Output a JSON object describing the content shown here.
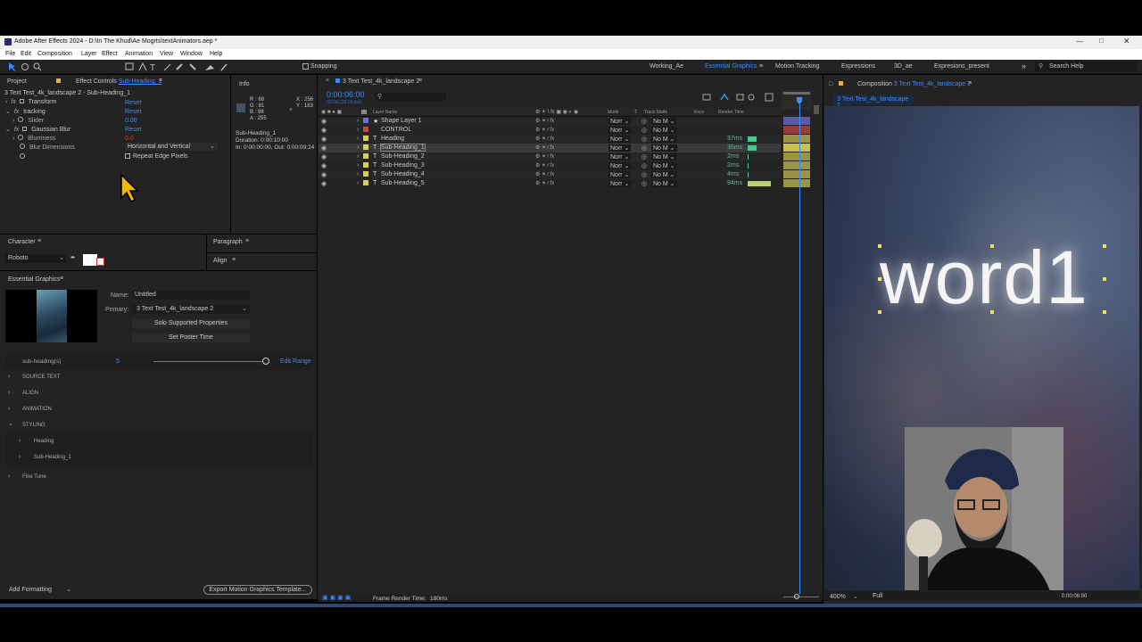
{
  "window": {
    "title": "Adobe After Effects 2024 - D:\\In The Khud\\Ae Mogrts\\textAnimators.aep *"
  },
  "menu": [
    "File",
    "Edit",
    "Composition",
    "Layer",
    "Effect",
    "Animation",
    "View",
    "Window",
    "Help"
  ],
  "toolbar": {
    "snapping": "Snapping",
    "workspaces": [
      "Working_Ae",
      "Essential Graphics",
      "Motion Tracking",
      "Expressions",
      "3D_ae",
      "Expresions_present"
    ],
    "active_workspace": "Essential Graphics",
    "search": "Search Help"
  },
  "effect_controls": {
    "tab_project": "Project",
    "tab_prefix": "Effect Controls",
    "tab_layer": "Sub-Heading_1",
    "header": "3 Text Test_4k_landscape 2 - Sub-Heading_1",
    "rows": [
      {
        "label": "Transform",
        "value": "Reset"
      },
      {
        "label": "tracking",
        "value": "Reset"
      },
      {
        "label": "Slider",
        "value": "0.00"
      },
      {
        "label": "Gaussian Blur",
        "value": "Reset"
      },
      {
        "label": "Blurriness",
        "value": "0.0"
      },
      {
        "label": "Blur Dimensions",
        "value": "Horizontal and Vertical"
      }
    ],
    "repeat_edge": "Repeat Edge Pixels"
  },
  "info": {
    "tab": "Info",
    "r": "R : 68",
    "g": "G : 81",
    "b": "B : 98",
    "a": "A : 255",
    "x": "X : 256",
    "y": "Y : 183",
    "layer": "Sub-Heading_1",
    "duration": "Duration: 0:00:10:00",
    "inout": "In: 0:00:00:00, Out: 0:00:09:24"
  },
  "timeline": {
    "tab": "3 Text Test_4k_landscape 2",
    "timecode": "0:00:06:00",
    "fps": "00150 (25.00 fps)",
    "col_layer_name": "Layer Name",
    "col_mode": "Mode",
    "col_t": "T",
    "col_track_matte": "Track Matte",
    "col_keys": "Keys",
    "col_render_time": "Render Time",
    "layers": [
      {
        "num": "1",
        "name": "Shape Layer 1",
        "type": "★",
        "color": "#6f6fd8",
        "mode": "Norr",
        "matte": "No M",
        "render": "",
        "bar": ""
      },
      {
        "num": "2",
        "name": "CONTROL",
        "type": "",
        "color": "#c84444",
        "mode": "Norr",
        "matte": "No M",
        "render": "",
        "bar": ""
      },
      {
        "num": "3",
        "name": "Heading",
        "type": "T",
        "color": "#d8d050",
        "mode": "Norr",
        "matte": "No M",
        "render": "37ms",
        "bar": "#3fc98f"
      },
      {
        "num": "4",
        "name": "Sub-Heading_1",
        "type": "T",
        "color": "#d8d050",
        "mode": "Norr",
        "matte": "No M",
        "render": "36ms",
        "bar": "#3fc98f"
      },
      {
        "num": "5",
        "name": "Sub-Heading_2",
        "type": "T",
        "color": "#d8d050",
        "mode": "Norr",
        "matte": "No M",
        "render": "2ms",
        "bar": ""
      },
      {
        "num": "6",
        "name": "Sub-Heading_3",
        "type": "T",
        "color": "#d8d050",
        "mode": "Norr",
        "matte": "No M",
        "render": "2ms",
        "bar": ""
      },
      {
        "num": "7",
        "name": "Sub-Heading_4",
        "type": "T",
        "color": "#d8d050",
        "mode": "Norr",
        "matte": "No M",
        "render": "4ms",
        "bar": ""
      },
      {
        "num": "8",
        "name": "Sub-Heading_5",
        "type": "T",
        "color": "#d8d050",
        "mode": "Norr",
        "matte": "No M",
        "render": "94ms",
        "bar": "#b8d070"
      }
    ],
    "frame_render_label": "Frame Render Time:",
    "frame_render_value": "180ms"
  },
  "character": {
    "tab": "Character",
    "font": "Roboto"
  },
  "paragraph": {
    "tab": "Paragraph"
  },
  "align": {
    "tab": "Align"
  },
  "essential_graphics": {
    "tab": "Essential Graphics",
    "name_label": "Name:",
    "name_value": "Untitled",
    "primary_label": "Primary:",
    "primary_value": "3 Text Test_4k_landscape 2",
    "solo_button": "Solo Supported Properties",
    "poster_button": "Set Poster Time",
    "slider_label": "sub-heading(s)",
    "slider_value": "5",
    "edit_range": "Edit Range",
    "sections": [
      "SOURCE TEXT",
      "ALIGN",
      "ANIMATION",
      "STYLING"
    ],
    "styling_children": [
      "Heading",
      "Sub-Heading_1"
    ],
    "fine_tune": "Fine Tune",
    "add_formatting": "Add Formatting",
    "export_button": "Export Motion Graphics Template..."
  },
  "composition": {
    "tab_prefix": "Composition",
    "tab_name": "3 Text Test_4k_landscape 2",
    "crumb": "3 Text Test_4k_landscape 2",
    "word": "word1",
    "zoom": "400%",
    "quality": "Full",
    "time": "0:00:06:00"
  }
}
